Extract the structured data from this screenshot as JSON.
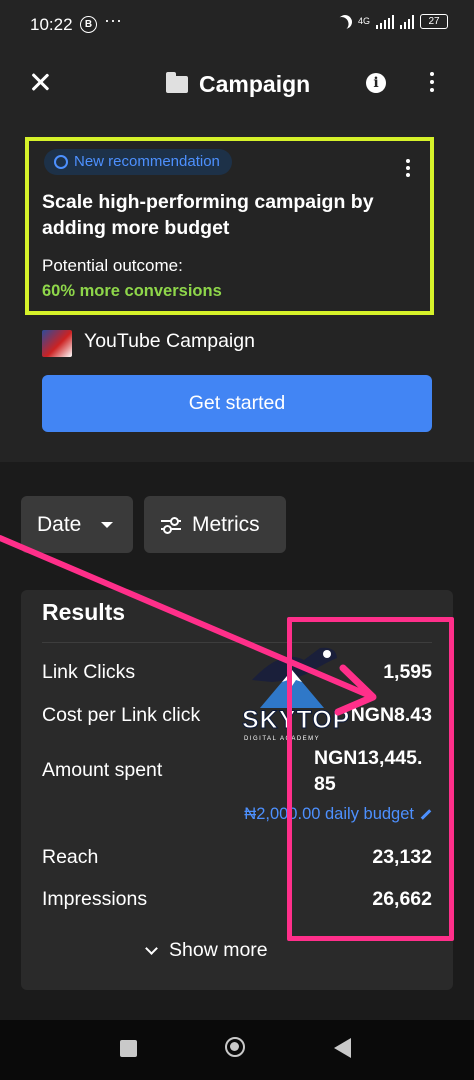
{
  "status_bar": {
    "time": "10:22",
    "b_icon": "B",
    "dots": "···",
    "network": "4G",
    "battery": "27"
  },
  "header": {
    "title": "Campaign",
    "info_glyph": "i"
  },
  "recommendation": {
    "badge": "New recommendation",
    "title": "Scale high-performing campaign by adding more budget",
    "outcome_label": "Potential outcome:",
    "outcome_value": "60% more conversions",
    "campaign_name": "YouTube Campaign",
    "cta": "Get started"
  },
  "filters": {
    "date_label": "Date",
    "metrics_label": "Metrics"
  },
  "results": {
    "title": "Results",
    "rows": [
      {
        "label": "Link Clicks",
        "value": "1,595"
      },
      {
        "label": "Cost per Link click",
        "value": "NGN8.43"
      },
      {
        "label": "Amount spent",
        "value": "NGN13,445.\n85"
      },
      {
        "label": "Reach",
        "value": "23,132"
      },
      {
        "label": "Impressions",
        "value": "26,662"
      }
    ],
    "budget_link": "₦2,000.00 daily budget",
    "show_more": "Show more"
  },
  "watermark": {
    "name": "SKYTOP",
    "tagline": "DIGITAL ACADEMY"
  },
  "colors": {
    "accent": "#4285f4",
    "highlight_yellow": "#d6f22a",
    "highlight_pink": "#ff2f8a",
    "success": "#8ed64a"
  }
}
